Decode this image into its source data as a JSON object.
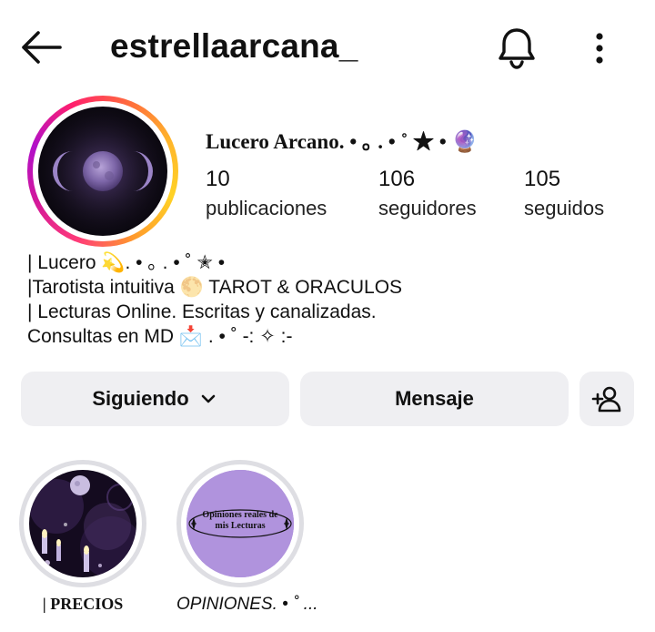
{
  "header": {
    "username": "estrellaarcana_",
    "back_icon": "arrow-left-icon",
    "notifications_icon": "bell-icon",
    "more_icon": "more-vertical-icon"
  },
  "profile": {
    "display_name": "Lucero Arcano. • ｡ . • ˚ ★ • 🔮",
    "stats": [
      {
        "value": "10",
        "label": "publicaciones"
      },
      {
        "value": "106",
        "label": "seguidores"
      },
      {
        "value": "105",
        "label": "seguidos"
      }
    ],
    "bio": [
      "| Lucero 💫. • ｡ . • ˚ ✭ •",
      "|Tarotista intuitiva 🌕 TAROT & ORACULOS",
      "| Lecturas Online. Escritas y canalizadas.",
      "Consultas en MD 📩 . • ˚ -: ✧ :-"
    ],
    "story_ring_colors": [
      "#ff3b78",
      "#b110c9",
      "#ffd226"
    ]
  },
  "actions": {
    "following_label": "Siguiendo",
    "message_label": "Mensaje",
    "add_person_icon": "add-person-icon"
  },
  "highlights": [
    {
      "label": "| PRECIOS",
      "cover_text": ""
    },
    {
      "label": "OPINIONES. • ˚ ...",
      "cover_text_line1": "Opiniones reales de",
      "cover_text_line2": "mis Lecturas"
    }
  ],
  "colors": {
    "button_bg": "#efeff2",
    "highlight_purple": "#a98ad9"
  }
}
